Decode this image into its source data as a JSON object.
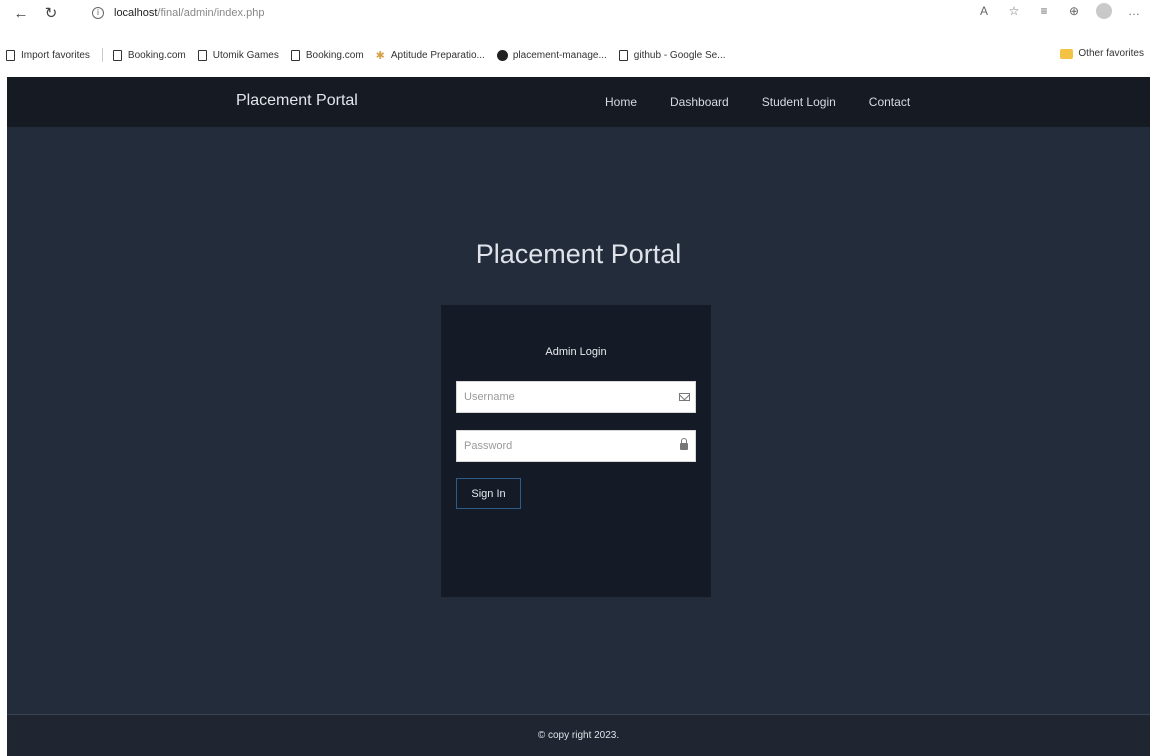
{
  "browser": {
    "url_host": "localhost",
    "url_path": "/final/admin/index.php",
    "bookmarks": [
      {
        "label": "Import favorites"
      },
      {
        "label": "Booking.com"
      },
      {
        "label": "Utomik Games"
      },
      {
        "label": "Booking.com"
      },
      {
        "label": "Aptitude Preparatio..."
      },
      {
        "label": "placement-manage..."
      },
      {
        "label": "github - Google Se..."
      }
    ],
    "other_favorites": "Other favorites"
  },
  "nav": {
    "brand": "Placement Portal",
    "items": [
      "Home",
      "Dashboard",
      "Student Login",
      "Contact"
    ]
  },
  "main": {
    "title": "Placement Portal",
    "login": {
      "heading": "Admin Login",
      "username_placeholder": "Username",
      "password_placeholder": "Password",
      "submit_label": "Sign In"
    }
  },
  "footer": {
    "text": "© copy right 2023."
  },
  "colors": {
    "nav_bg": "#161b23",
    "page_bg": "#232c3b",
    "card_bg": "#151b26",
    "button_border": "#2e5c8a"
  },
  "icons": {
    "back": "back-arrow-icon",
    "refresh": "refresh-icon",
    "info": "info-icon",
    "username_field": "mail-icon",
    "password_field": "lock-icon",
    "profile": "profile-avatar"
  }
}
